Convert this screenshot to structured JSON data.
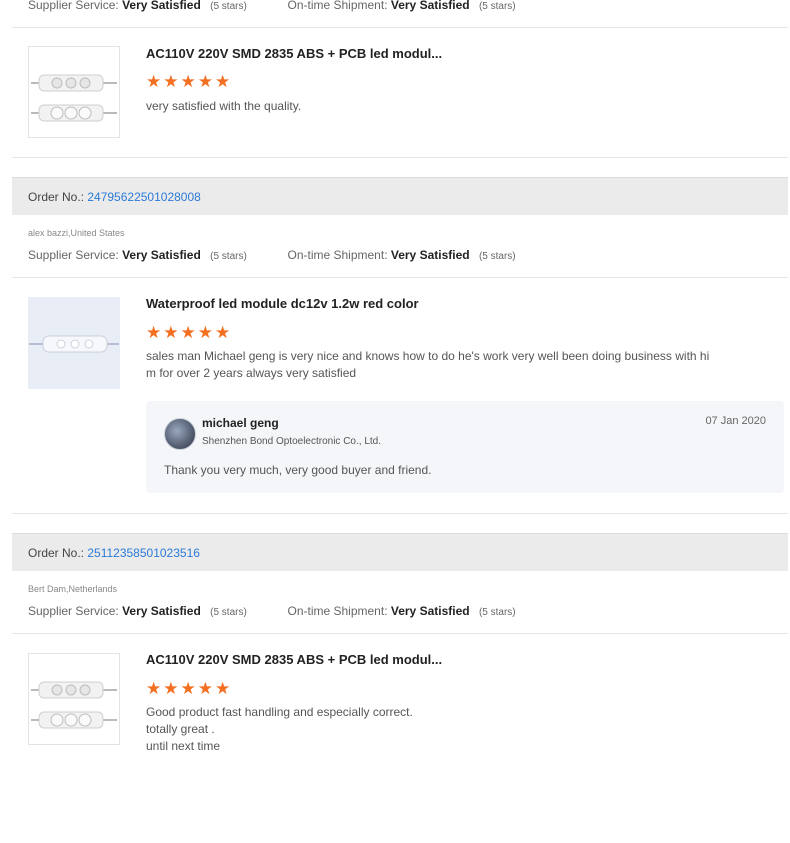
{
  "colors": {
    "star": "#f36f21",
    "link": "#2a7ad8"
  },
  "labels": {
    "order_no": "Order No.:",
    "supplier_service": "Supplier Service:",
    "on_time_shipment": "On-time Shipment:"
  },
  "top_service": {
    "supplier_value": "Very Satisfied",
    "supplier_stars": "(5 stars)",
    "shipment_value": "Very Satisfied",
    "shipment_stars": "(5 stars)"
  },
  "review1": {
    "product_title": "AC110V 220V SMD 2835 ABS + PCB led modul...",
    "rating": 5,
    "comment": "very satisfied with the quality."
  },
  "order2": {
    "number": "24795622501028008",
    "buyer": "alex bazzi,United States",
    "supplier_value": "Very Satisfied",
    "supplier_stars": "(5 stars)",
    "shipment_value": "Very Satisfied",
    "shipment_stars": "(5 stars)",
    "product_title": "Waterproof led module dc12v 1.2w red color",
    "rating": 5,
    "comment_line1": "sales man Michael geng is very nice and knows how to do he's work very well been doing business with hi",
    "comment_line2": "m for over 2 years always very satisfied",
    "reply": {
      "name": "michael geng",
      "company": "Shenzhen Bond Optoelectronic Co., Ltd.",
      "date": "07 Jan 2020",
      "text": "Thank you very much, very good buyer and friend."
    }
  },
  "order3": {
    "number": "25112358501023516",
    "buyer": "Bert Dam,Netherlands",
    "supplier_value": "Very Satisfied",
    "supplier_stars": "(5 stars)",
    "shipment_value": "Very Satisfied",
    "shipment_stars": "(5 stars)",
    "product_title": "AC110V 220V SMD 2835 ABS + PCB led modul...",
    "rating": 5,
    "comment_line1": "Good product fast handling and especially correct.",
    "comment_line2": "totally great .",
    "comment_line3": "until next time"
  }
}
